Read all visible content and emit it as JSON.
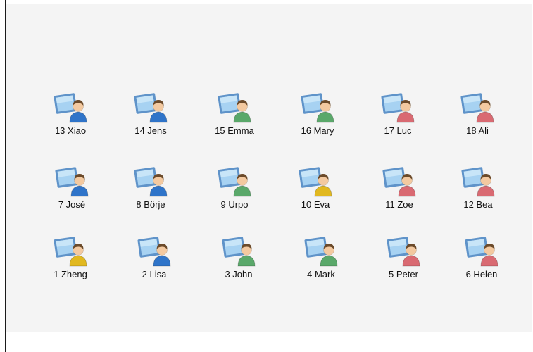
{
  "stations": [
    {
      "label": "13 Xiao",
      "shirt": "blue"
    },
    {
      "label": "14 Jens",
      "shirt": "blue"
    },
    {
      "label": "15 Emma",
      "shirt": "green"
    },
    {
      "label": "16 Mary",
      "shirt": "green"
    },
    {
      "label": "17 Luc",
      "shirt": "red"
    },
    {
      "label": "18 Ali",
      "shirt": "red"
    },
    {
      "label": "7 José",
      "shirt": "blue"
    },
    {
      "label": "8 Börje",
      "shirt": "blue"
    },
    {
      "label": "9 Urpo",
      "shirt": "green"
    },
    {
      "label": "10 Eva",
      "shirt": "yellow"
    },
    {
      "label": "11 Zoe",
      "shirt": "red"
    },
    {
      "label": "12 Bea",
      "shirt": "red"
    },
    {
      "label": "1 Zheng",
      "shirt": "yellow"
    },
    {
      "label": "2 Lisa",
      "shirt": "blue"
    },
    {
      "label": "3 John",
      "shirt": "green"
    },
    {
      "label": "4 Mark",
      "shirt": "green"
    },
    {
      "label": "5 Peter",
      "shirt": "red"
    },
    {
      "label": "6 Helen",
      "shirt": "red"
    }
  ],
  "colors": {
    "blue": "#2f74c9",
    "green": "#5aa86a",
    "red": "#d96a72",
    "yellow": "#e1b81f",
    "hair": "#6b4a2a",
    "skin": "#f3c9a0",
    "monitor": "#a7d2f2",
    "monitor_frame": "#5f93c9"
  }
}
